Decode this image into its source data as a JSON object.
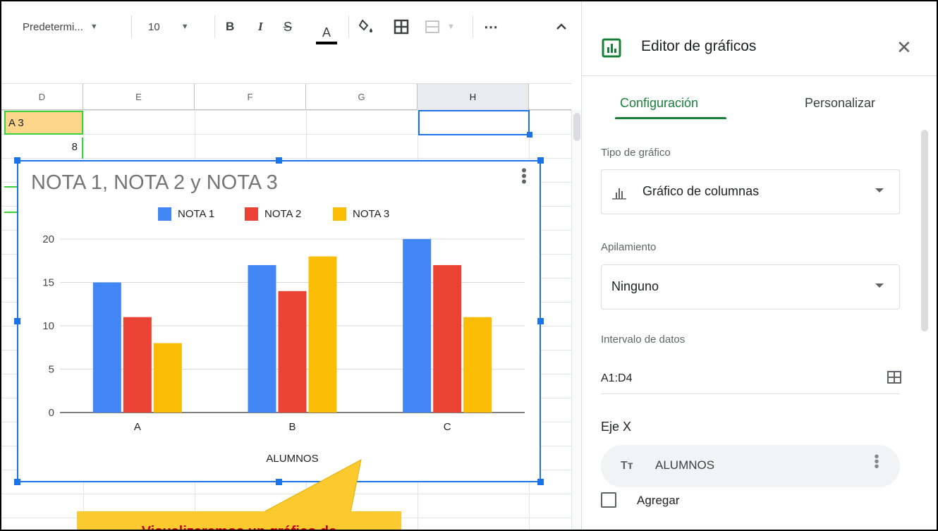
{
  "toolbar": {
    "font_name": "Predetermi...",
    "font_size": "10",
    "bold": "B",
    "italic": "I",
    "strike": "S",
    "text_color_letter": "A",
    "more": "⋯"
  },
  "sheet": {
    "columns": [
      "D",
      "E",
      "F",
      "G",
      "H"
    ],
    "selected_column": "H",
    "cell_a3": "A 3",
    "cell_value": "8"
  },
  "chart_data": {
    "type": "bar",
    "title": "NOTA 1, NOTA 2 y NOTA 3",
    "xlabel": "ALUMNOS",
    "ylabel": "",
    "categories": [
      "A",
      "B",
      "C"
    ],
    "series": [
      {
        "name": "NOTA 1",
        "values": [
          15,
          17,
          20
        ],
        "color": "#4285f4"
      },
      {
        "name": "NOTA 2",
        "values": [
          11,
          14,
          17
        ],
        "color": "#ea4335"
      },
      {
        "name": "NOTA 3",
        "values": [
          8,
          18,
          11
        ],
        "color": "#fbbc04"
      }
    ],
    "yticks": [
      0,
      5,
      10,
      15,
      20
    ],
    "ylim": [
      0,
      20
    ],
    "grid": true,
    "legend_position": "top"
  },
  "callout": {
    "text": "Visualizaremos un gráfico de"
  },
  "panel": {
    "title": "Editor de gráficos",
    "close": "✕",
    "tabs": [
      {
        "label": "Configuración",
        "active": true
      },
      {
        "label": "Personalizar",
        "active": false
      }
    ],
    "chart_type_label": "Tipo de gráfico",
    "chart_type_value": "Gráfico de columnas",
    "stacking_label": "Apilamiento",
    "stacking_value": "Ninguno",
    "range_label": "Intervalo de datos",
    "range_value": "A1:D4",
    "x_axis_label": "Eje X",
    "x_axis_chip": "ALUMNOS",
    "x_axis_chip_icon": "Tт",
    "add_label": "Agregar"
  },
  "colors": {
    "accent_green": "#188038",
    "selection_blue": "#1a73e8",
    "callout_yellow": "#fcc92e",
    "callout_text": "#c5050c"
  }
}
